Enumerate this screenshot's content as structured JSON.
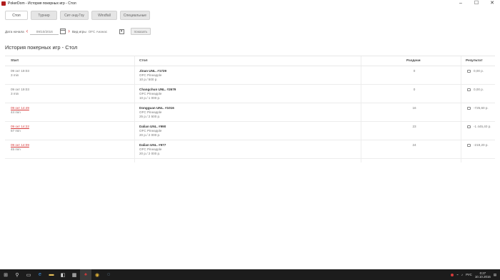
{
  "window": {
    "title": "PokerDom - История покерных игр - Стол"
  },
  "tabs": [
    {
      "label": "Стол",
      "active": true
    },
    {
      "label": "Турнир",
      "active": false
    },
    {
      "label": "Сит-энд-Гоу",
      "active": false
    },
    {
      "label": "Windfall",
      "active": false
    },
    {
      "label": "Специальные",
      "active": false
    }
  ],
  "filters": {
    "date_label": "Дата начала",
    "date_value": "09/10/2016",
    "game_label": "Вид игры",
    "game_value": "OFC Ананас",
    "show_button": "показать"
  },
  "page_title": "История покерных игр - Стол",
  "table": {
    "headers": {
      "start": "Start",
      "table": "Стол",
      "hands": "Раздачи",
      "result": "Результат"
    },
    "rows": [
      {
        "date": "09 окт 19:03",
        "duration": "3 min",
        "name": "Jinan UNL. #1729",
        "game": "OFC Pineapple",
        "stakes": "10 р./ 500 р.",
        "hands": "0",
        "result": "0,00 р.",
        "highlight": false
      },
      {
        "date": "09 окт 19:03",
        "duration": "3 min",
        "name": "Changchun UNL. #2679",
        "game": "OFC Pineapple",
        "stakes": "10 р./ 1 000 р.",
        "hands": "0",
        "result": "0,00 р.",
        "highlight": false
      },
      {
        "date": "09 окт 14:49",
        "duration": "44 min",
        "name": "Dongguan UNL. #1016",
        "game": "OFC Pineapple",
        "stakes": "25 р./ 2 500 р.",
        "hands": "16",
        "result": "-725,60 р.",
        "highlight": true
      },
      {
        "date": "09 окт 14:22",
        "duration": "57 min",
        "name": "Dalian UNL. #990",
        "game": "OFC Pineapple",
        "stakes": "20 р./ 2 000 р.",
        "hands": "23",
        "result": "-1 445,40 р.",
        "highlight": true
      },
      {
        "date": "09 окт 14:09",
        "duration": "45 min",
        "name": "Dalian UNL. #977",
        "game": "OFC Pineapple",
        "stakes": "20 р./ 2 000 р.",
        "hands": "24",
        "result": "-219,20 р.",
        "highlight": true
      }
    ]
  },
  "taskbar": {
    "tray_lang": "РУС",
    "time": "0:27",
    "date": "10.10.2016"
  },
  "colors": {
    "accent_red": "#d63a3a",
    "taskbar": "#1c1c1c"
  }
}
